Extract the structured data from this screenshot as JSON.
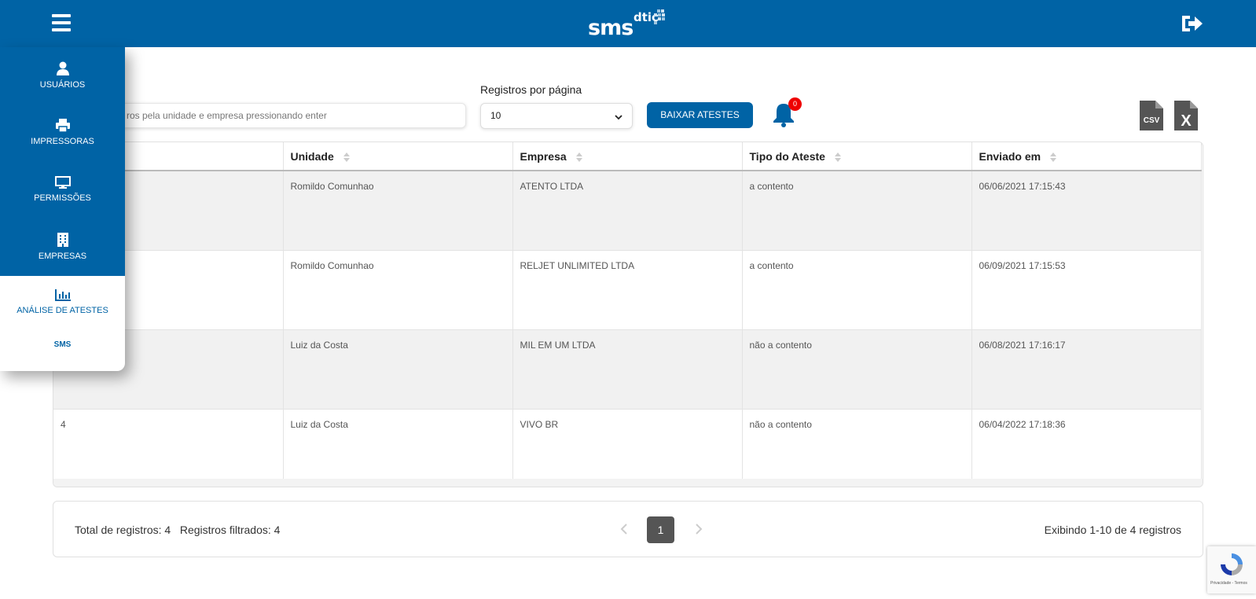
{
  "header": {
    "logo_main": "sms",
    "logo_sup": "dtic"
  },
  "sidebar": {
    "items": [
      {
        "label": "USUÁRIOS",
        "icon": "user-icon"
      },
      {
        "label": "IMPRESSORAS",
        "icon": "printer-icon"
      },
      {
        "label": "PERMISSÕES",
        "icon": "monitor-icon"
      },
      {
        "label": "EMPRESAS",
        "icon": "building-icon"
      },
      {
        "label": "ANÁLISE DE ATESTES",
        "icon": "bar-chart-icon"
      },
      {
        "label": "SMS",
        "icon": ""
      }
    ],
    "colors": {
      "primary": "#0063a5"
    }
  },
  "toolbar": {
    "search_placeholder": "Pesquise os registros pela unidade e empresa pressionando enter",
    "search_visible": "ros pela unidade e empresa pressionando enter",
    "per_page_label": "Registros por página",
    "per_page_value": "10",
    "download_label": "BAIXAR ATESTES",
    "notification_count": "0",
    "csv_label": "CSV",
    "xls_label": "X"
  },
  "table": {
    "columns": [
      "",
      "Unidade",
      "Empresa",
      "Tipo do Ateste",
      "Enviado em"
    ],
    "rows": [
      {
        "id": "",
        "unidade": "Romildo Comunhao",
        "empresa": "ATENTO LTDA",
        "tipo": "a contento",
        "enviado": "06/06/2021 17:15:43"
      },
      {
        "id": "",
        "unidade": "Romildo Comunhao",
        "empresa": "RELJET UNLIMITED LTDA",
        "tipo": "a contento",
        "enviado": "06/09/2021 17:15:53"
      },
      {
        "id": "",
        "unidade": "Luiz da Costa",
        "empresa": "MIL EM UM LTDA",
        "tipo": "não a contento",
        "enviado": "06/08/2021 17:16:17"
      },
      {
        "id": "4",
        "unidade": "Luiz da Costa",
        "empresa": "VIVO BR",
        "tipo": "não a contento",
        "enviado": "06/04/2022 17:18:36"
      }
    ]
  },
  "footer": {
    "totals": "Total de registros: 4   Registros filtrados: 4",
    "current_page": "1",
    "showing": "Exibindo 1-10 de 4 registros"
  },
  "recaptcha": {
    "text": "Privacidade - Termos"
  }
}
